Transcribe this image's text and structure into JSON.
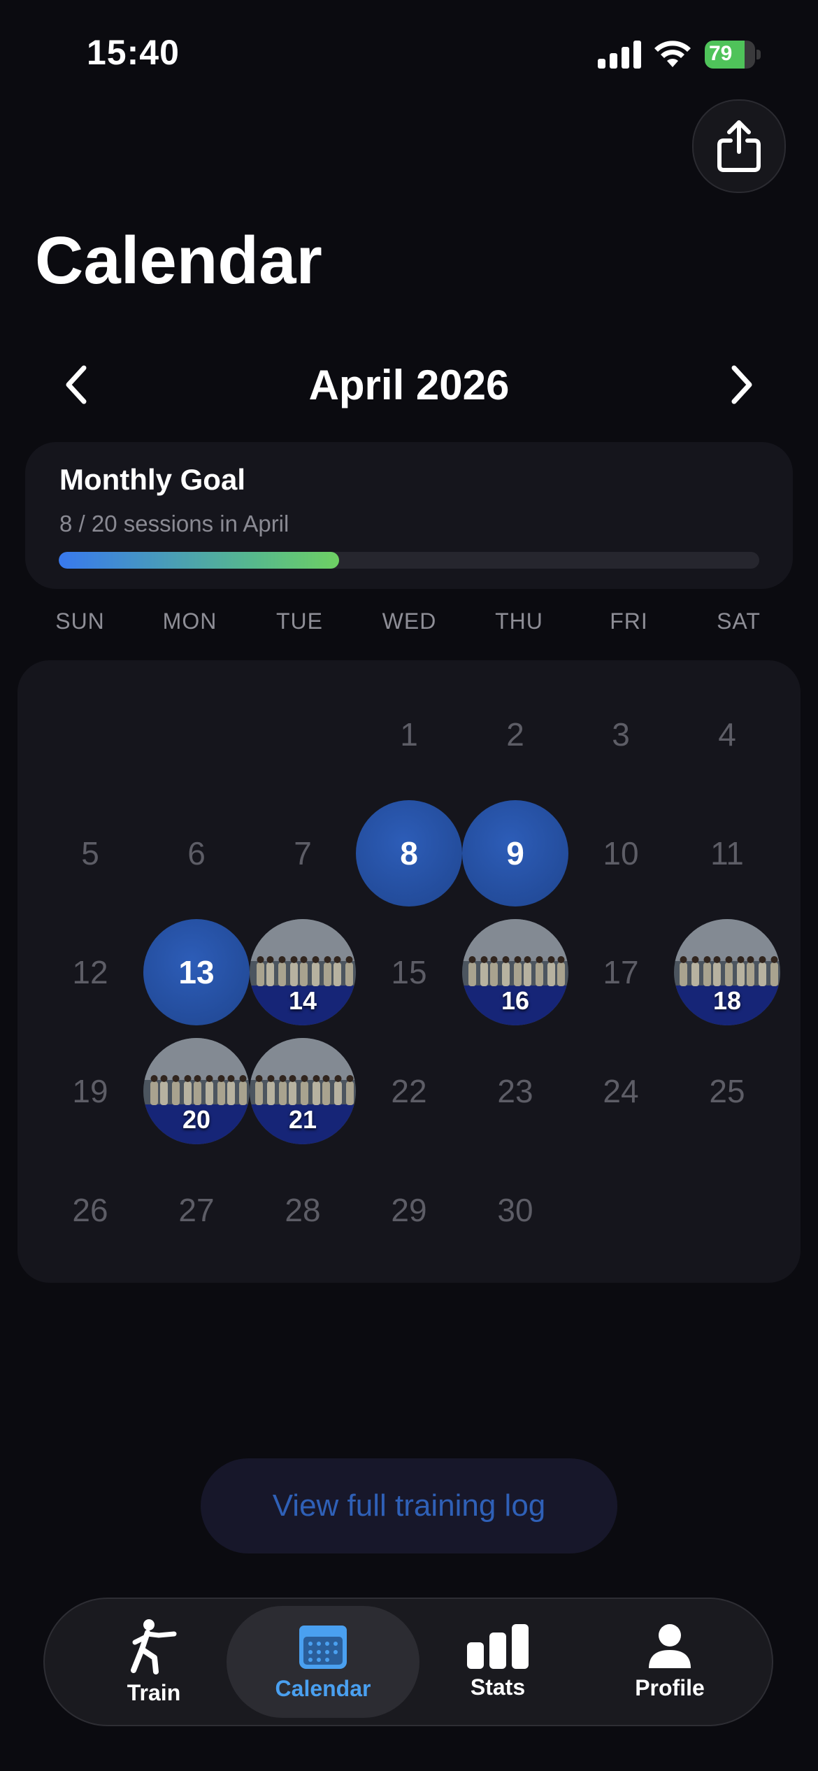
{
  "status": {
    "time": "15:40",
    "battery_percent": 79,
    "battery_text": "79"
  },
  "header": {
    "title": "Calendar",
    "share_icon": "share-icon"
  },
  "month_nav": {
    "label": "April 2026",
    "prev_icon": "chevron-left-icon",
    "next_icon": "chevron-right-icon"
  },
  "goal": {
    "title": "Monthly Goal",
    "subtitle": "8 / 20 sessions in April",
    "progress_fraction": 0.4
  },
  "weekdays": [
    "SUN",
    "MON",
    "TUE",
    "WED",
    "THU",
    "FRI",
    "SAT"
  ],
  "calendar": {
    "first_weekday_index": 3,
    "days_in_month": 30,
    "session_days": [
      8,
      9,
      13
    ],
    "photo_days": [
      14,
      16,
      18,
      20,
      21
    ],
    "selected_day": 21
  },
  "log_button": {
    "label": "View full training log"
  },
  "tabs": [
    {
      "label": "Train",
      "icon": "running-figure-icon",
      "active": false
    },
    {
      "label": "Calendar",
      "icon": "calendar-icon",
      "active": true
    },
    {
      "label": "Stats",
      "icon": "bar-chart-icon",
      "active": false
    },
    {
      "label": "Profile",
      "icon": "person-icon",
      "active": false
    }
  ],
  "colors": {
    "accent": "#3a86f5",
    "session_fill": "#2a56a8",
    "active_tab": "#4aa0f0",
    "background": "#0b0b10"
  }
}
